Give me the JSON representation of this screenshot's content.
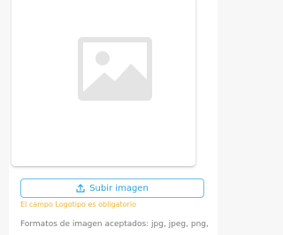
{
  "image_card": {
    "placeholder_icon": "image-placeholder-icon"
  },
  "upload": {
    "button_label": "Subir imagen",
    "icon": "upload-icon",
    "accent_color": "#2aa4df"
  },
  "validation": {
    "error_message": "El campo Logotipo es obligatorio",
    "error_color": "#f0b32a"
  },
  "help": {
    "formats_text": "Formatos de imagen aceptados: jpg, jpeg, png, gif"
  }
}
